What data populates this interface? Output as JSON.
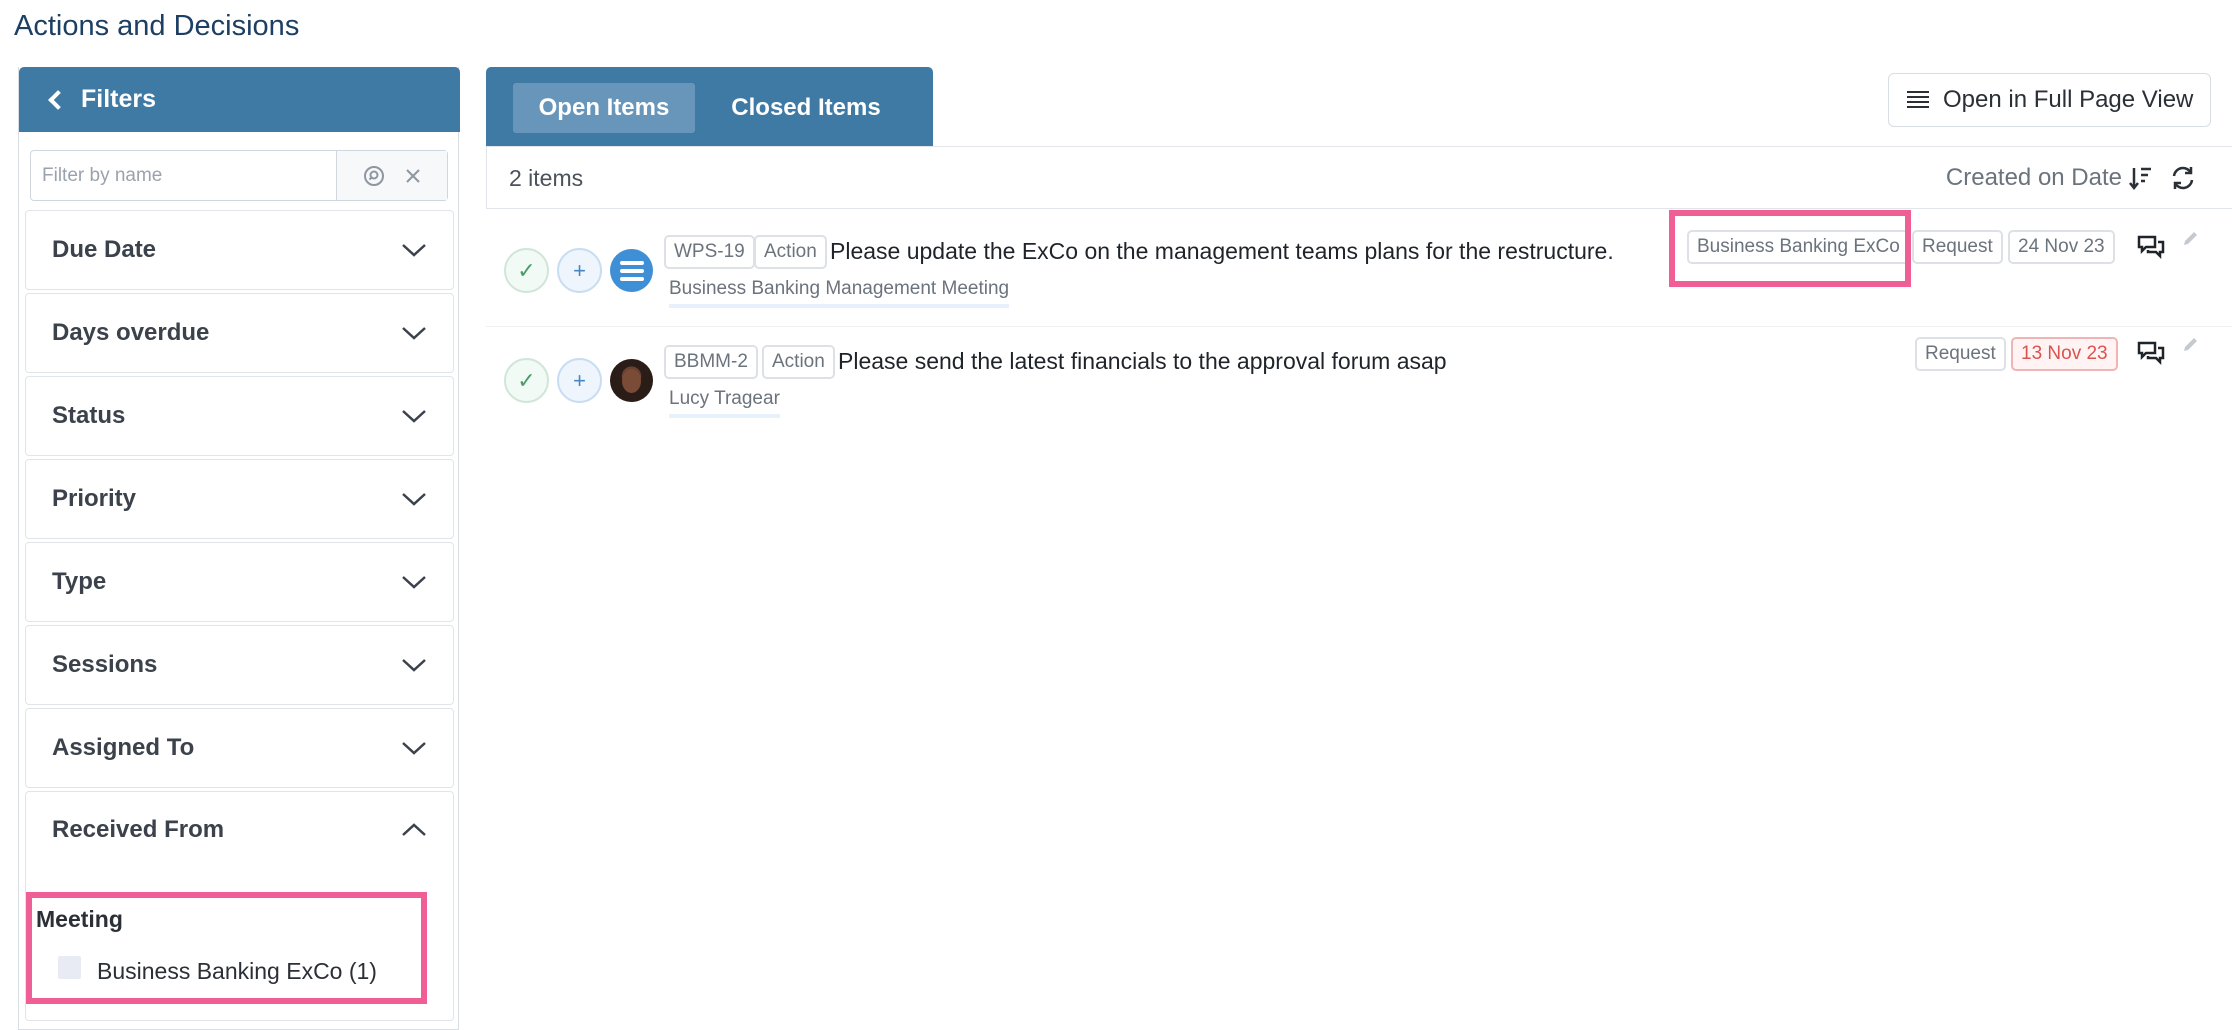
{
  "page": {
    "title": "Actions and Decisions"
  },
  "filters": {
    "header": "Filters",
    "search_placeholder": "Filter by name",
    "sections": [
      {
        "label": "Due Date",
        "expanded": false
      },
      {
        "label": "Days overdue",
        "expanded": false
      },
      {
        "label": "Status",
        "expanded": false
      },
      {
        "label": "Priority",
        "expanded": false
      },
      {
        "label": "Type",
        "expanded": false
      },
      {
        "label": "Sessions",
        "expanded": false
      },
      {
        "label": "Assigned To",
        "expanded": false
      },
      {
        "label": "Received From",
        "expanded": true
      }
    ],
    "received_from": {
      "group_title": "Meeting",
      "options": [
        {
          "label": "Business Banking ExCo (1)",
          "checked": false
        }
      ]
    }
  },
  "tabs": {
    "open": "Open Items",
    "closed": "Closed Items",
    "active": "open"
  },
  "toolbar": {
    "full_page_label": "Open in Full Page View"
  },
  "list": {
    "count_label": "2 items",
    "sort_label": "Created on Date",
    "items": [
      {
        "id": "WPS-19",
        "kind": "Action",
        "title": "Please update the ExCo on the management teams plans for the restructure.",
        "subtitle": "Business Banking Management Meeting",
        "source_tag": "Business Banking ExCo",
        "type_tag": "Request",
        "date": "24 Nov 23",
        "overdue": false,
        "avatar": "list-avatar-icon"
      },
      {
        "id": "BBMM-2",
        "kind": "Action",
        "title": "Please send the latest financials to the approval forum asap",
        "subtitle": "Lucy Tragear",
        "type_tag": "Request",
        "date": "13 Nov 23",
        "overdue": true,
        "avatar": "user-photo-avatar"
      }
    ]
  },
  "colors": {
    "header_blue": "#3e7aa4",
    "active_tab": "#6895ba",
    "highlight_pink": "#ef5f96",
    "overdue_red": "#d9534f"
  }
}
